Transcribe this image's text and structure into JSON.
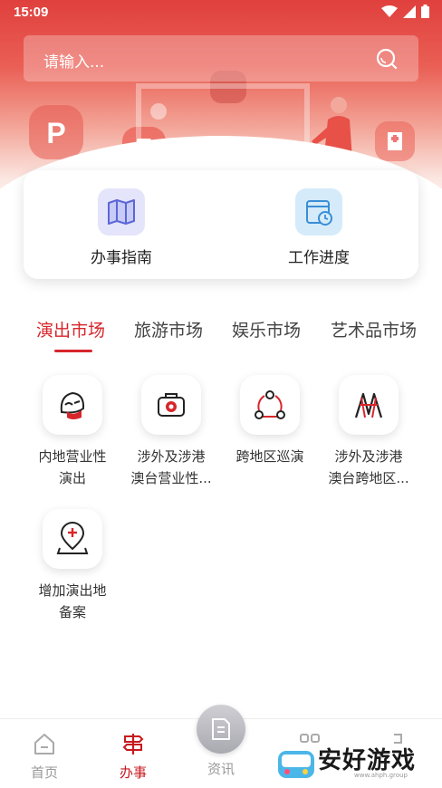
{
  "status_bar": {
    "time": "15:09"
  },
  "search": {
    "placeholder": "请输入..."
  },
  "quick_actions": [
    {
      "label": "办事指南",
      "icon": "map-icon"
    },
    {
      "label": "工作进度",
      "icon": "schedule-icon"
    }
  ],
  "tabs": [
    {
      "label": "演出市场",
      "active": true
    },
    {
      "label": "旅游市场",
      "active": false
    },
    {
      "label": "娱乐市场",
      "active": false
    },
    {
      "label": "艺术品市场",
      "active": false
    }
  ],
  "services": [
    {
      "line1": "内地营业性",
      "line2": "演出",
      "icon": "mask-icon"
    },
    {
      "line1": "涉外及涉港",
      "line2": "澳台营业性...",
      "icon": "briefcase-icon"
    },
    {
      "line1": "跨地区巡演",
      "line2": "",
      "icon": "network-icon"
    },
    {
      "line1": "涉外及涉港",
      "line2": "澳台跨地区...",
      "icon": "stage-icon"
    },
    {
      "line1": "增加演出地",
      "line2": "备案",
      "icon": "location-add-icon"
    }
  ],
  "bottom_nav": [
    {
      "label": "首页",
      "icon": "home-icon",
      "active": false
    },
    {
      "label": "办事",
      "icon": "signpost-icon",
      "active": true
    },
    {
      "label": "资讯",
      "icon": "news-icon",
      "active": false
    }
  ],
  "watermark": {
    "title": "安好游戏",
    "subtitle": "www.ahph.group"
  },
  "colors": {
    "brand_red": "#d7262b",
    "active_nav": "#c7191e"
  }
}
